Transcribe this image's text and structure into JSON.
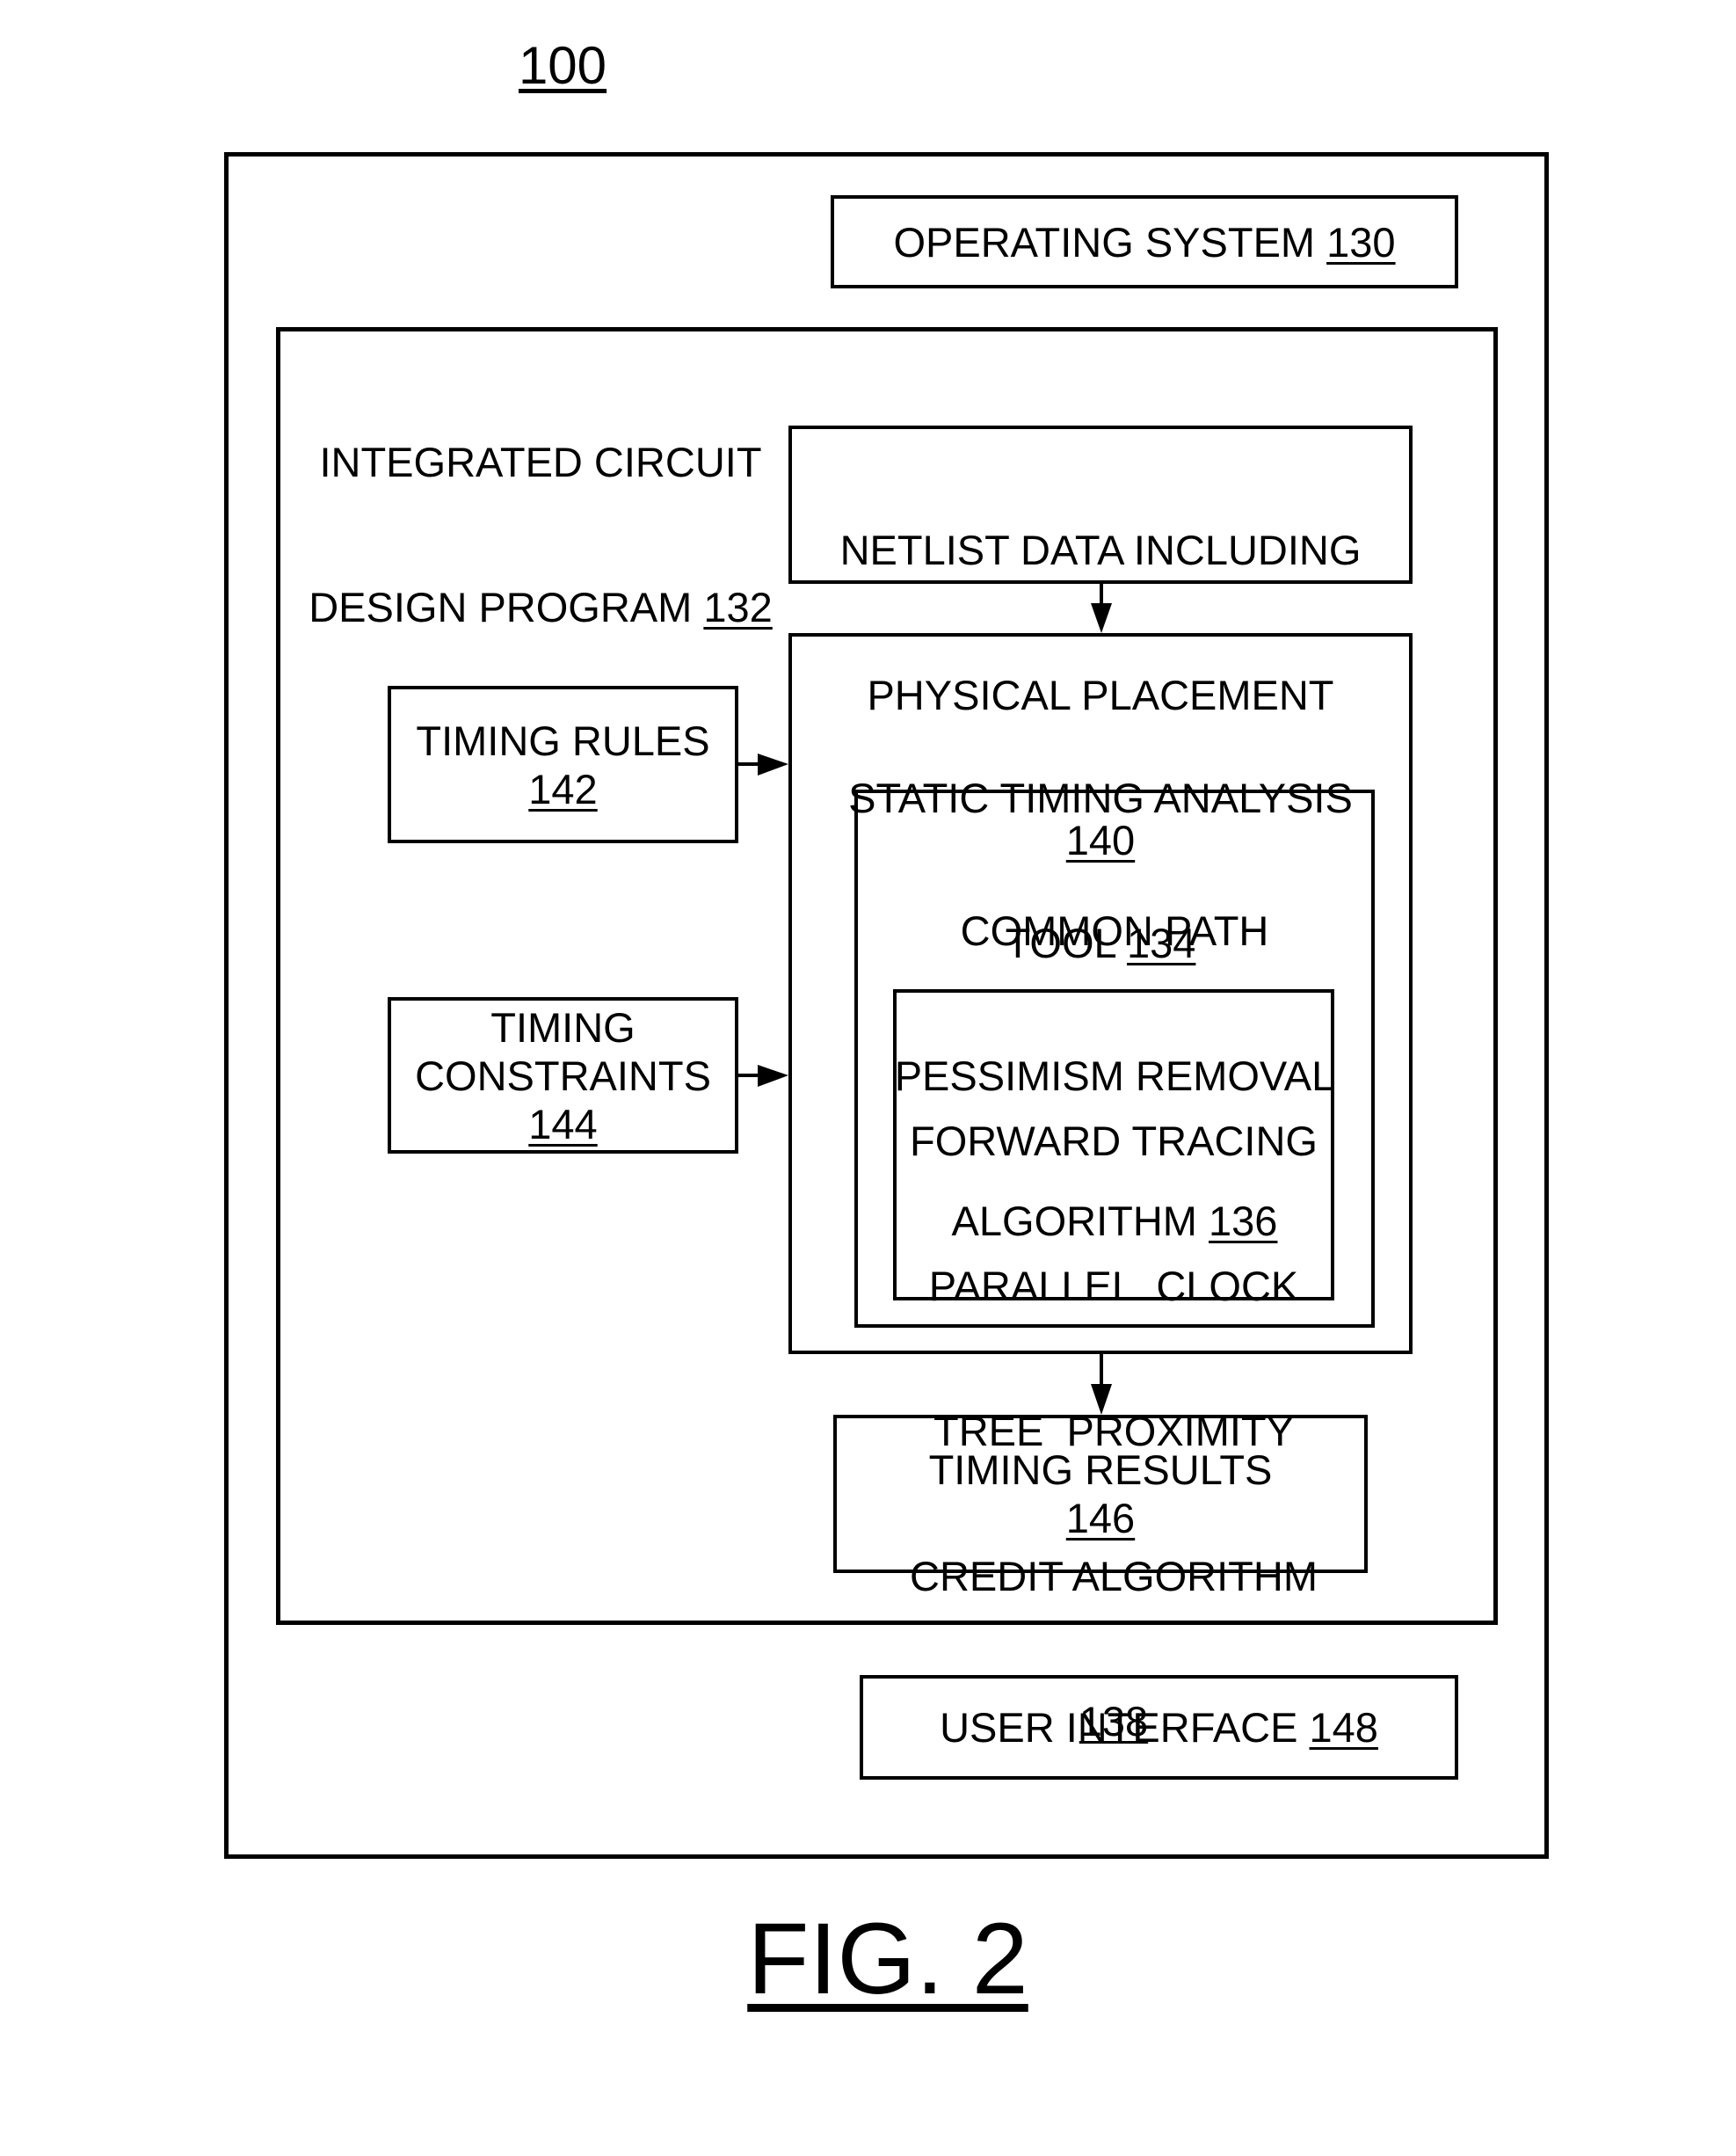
{
  "figure": {
    "reference": "100",
    "caption": "FIG. 2"
  },
  "blocks": {
    "operating_system": {
      "lines": [
        "OPERATING SYSTEM "
      ],
      "ref": "130"
    },
    "design_program": {
      "lines": [
        "INTEGRATED CIRCUIT",
        "DESIGN PROGRAM "
      ],
      "ref": "132"
    },
    "netlist": {
      "lines": [
        "NETLIST DATA INCLUDING",
        "PHYSICAL PLACEMENT"
      ],
      "ref": "140"
    },
    "sta_tool": {
      "lines": [
        "STATIC TIMING ANALYSIS",
        "TOOL "
      ],
      "ref": "134"
    },
    "timing_rules": {
      "lines": [
        "TIMING RULES"
      ],
      "ref": "142"
    },
    "timing_constraints": {
      "lines": [
        "TIMING",
        "CONSTRAINTS"
      ],
      "ref": "144"
    },
    "cppr": {
      "lines": [
        "COMMON PATH",
        "PESSIMISM REMOVAL",
        "ALGORITHM "
      ],
      "ref": "136"
    },
    "forward_tracing": {
      "lines": [
        "FORWARD TRACING",
        "PARALLEL  CLOCK",
        "TREE  PROXIMITY",
        "CREDIT ALGORITHM"
      ],
      "ref": "138"
    },
    "timing_results": {
      "lines": [
        "TIMING RESULTS"
      ],
      "ref": "146"
    },
    "user_interface": {
      "lines": [
        "USER INTERFACE "
      ],
      "ref": "148"
    }
  },
  "connections": [
    {
      "from": "netlist",
      "to": "sta_tool"
    },
    {
      "from": "timing_rules",
      "to": "sta_tool"
    },
    {
      "from": "timing_constraints",
      "to": "sta_tool"
    },
    {
      "from": "sta_tool",
      "to": "timing_results"
    }
  ]
}
